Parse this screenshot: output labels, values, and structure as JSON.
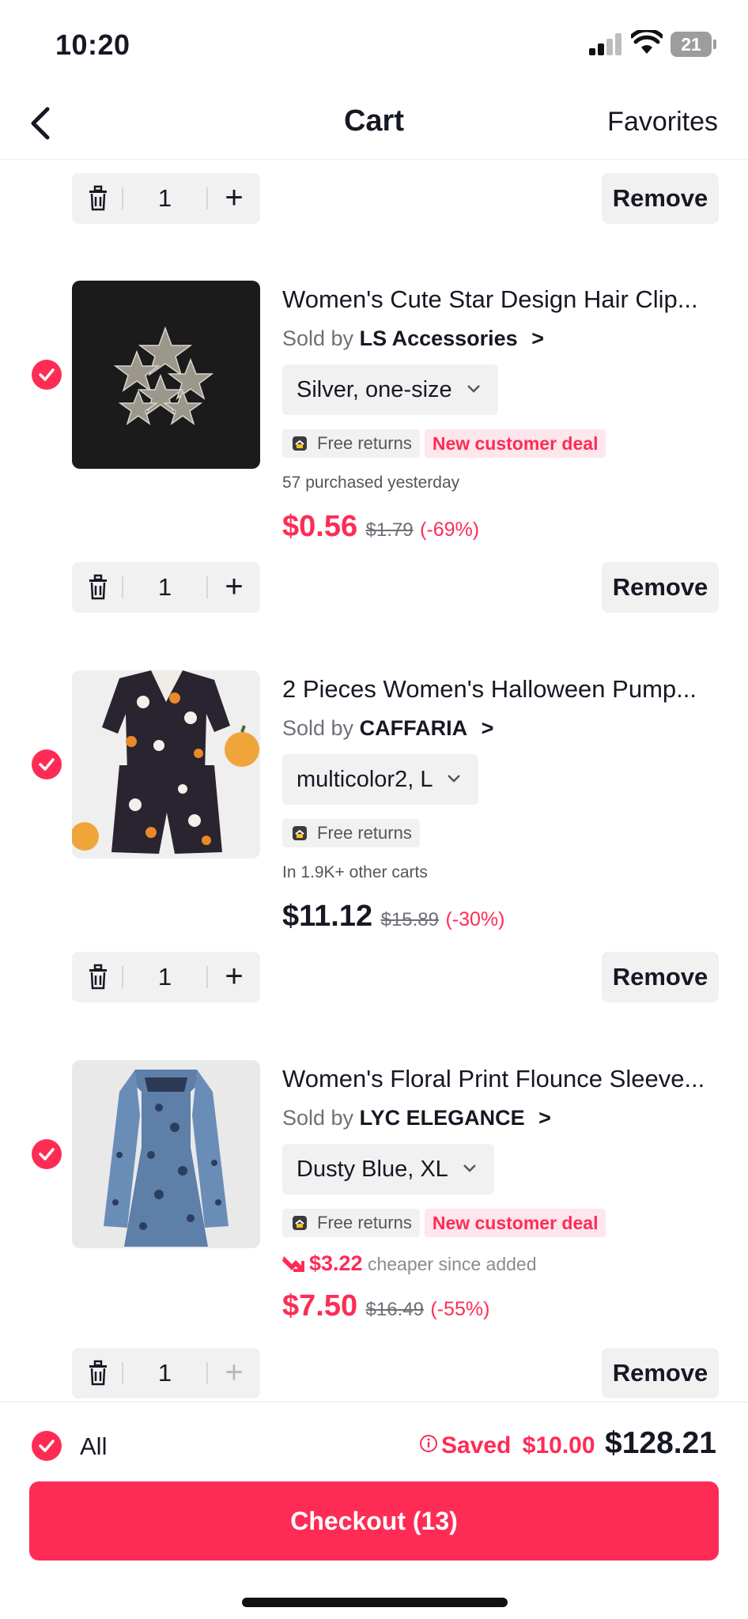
{
  "status": {
    "time": "10:20",
    "battery": "21"
  },
  "nav": {
    "title": "Cart",
    "favorites": "Favorites"
  },
  "top_row": {
    "quantity": "1",
    "remove_label": "Remove"
  },
  "items": [
    {
      "title": "Women's Cute Star Design Hair Clip...",
      "sold_by_prefix": "Sold by",
      "seller": "LS Accessories",
      "variant": "Silver, one-size",
      "free_returns": "Free returns",
      "deal": "New customer deal",
      "social": "57 purchased yesterday",
      "price": "$0.56",
      "original_price": "$1.79",
      "discount": "(-69%)",
      "quantity": "1",
      "remove_label": "Remove",
      "selected": true
    },
    {
      "title": "2 Pieces Women's Halloween Pump...",
      "sold_by_prefix": "Sold by",
      "seller": "CAFFARIA",
      "variant": "multicolor2, L",
      "free_returns": "Free returns",
      "social": "In 1.9K+ other carts",
      "price": "$11.12",
      "original_price": "$15.89",
      "discount": "(-30%)",
      "quantity": "1",
      "remove_label": "Remove",
      "selected": true
    },
    {
      "title": "Women's Floral Print Flounce Sleeve...",
      "sold_by_prefix": "Sold by",
      "seller": "LYC ELEGANCE",
      "variant": "Dusty Blue, XL",
      "free_returns": "Free returns",
      "deal": "New customer deal",
      "price_drop_amount": "$3.22",
      "price_drop_text": "cheaper since added",
      "price": "$7.50",
      "original_price": "$16.49",
      "discount": "(-55%)",
      "quantity": "1",
      "remove_label": "Remove",
      "selected": true
    }
  ],
  "footer": {
    "all_label": "All",
    "saved_label": "Saved",
    "saved_amount": "$10.00",
    "total": "$128.21",
    "checkout_label": "Checkout (13)"
  },
  "colors": {
    "accent": "#fe2c55",
    "text": "#161823",
    "chip_bg": "#f1f1f2"
  }
}
